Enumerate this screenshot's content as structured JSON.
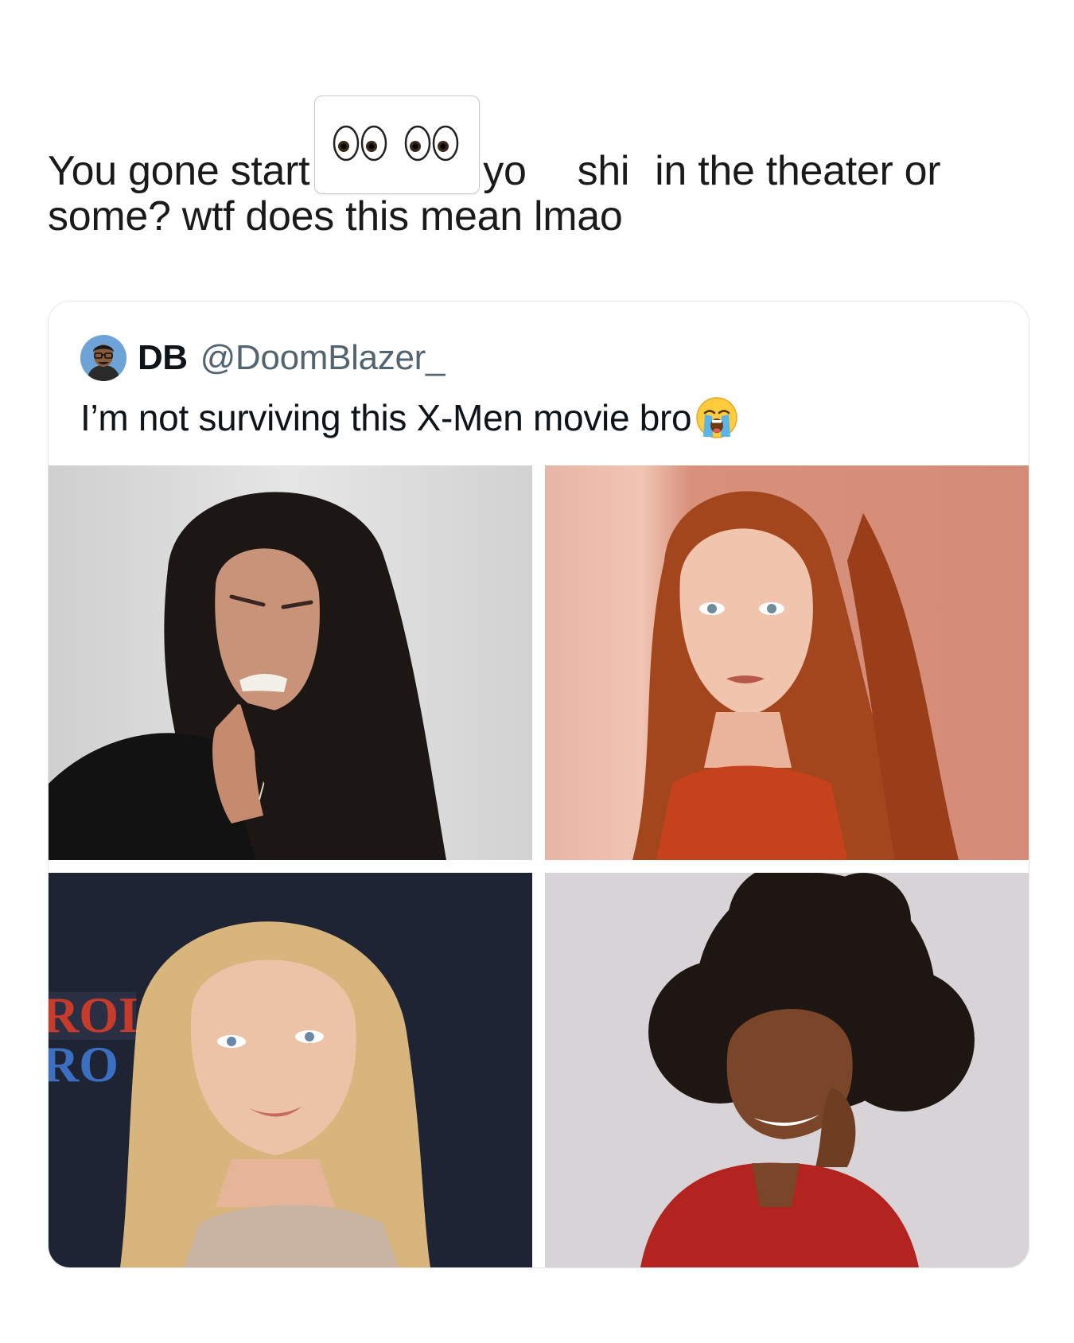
{
  "post": {
    "caption_part1": "You gone start",
    "caption_emoji": "eyes-emoji-row",
    "caption_part2": "yo",
    "caption_part3": "shi",
    "caption_part4": "in the theater or",
    "caption_line2": "some? wtf does this mean lmao"
  },
  "quoted_tweet": {
    "display_name": "DB",
    "handle": "@DoomBlazer_",
    "text": "I’m not surviving this X-Men movie bro",
    "text_emoji": "loudly-crying-face-emoji",
    "avatar_icon": "cartoon-avatar-icon",
    "photos": [
      {
        "name": "photo-dark-hair-woman",
        "bg": "#dcdcdc",
        "hair": "#1c1614",
        "top": "#121212"
      },
      {
        "name": "photo-red-hair-woman",
        "bg": "#d99a85",
        "hair": "#a3461e",
        "top": "#c5421c"
      },
      {
        "name": "photo-blonde-woman",
        "bg": "#1f2435",
        "hair": "#d8b57c",
        "top": "#c9b3a3"
      },
      {
        "name": "photo-curly-hair-woman",
        "bg": "#d8d3d6",
        "hair": "#1e1612",
        "top": "#b3231f"
      }
    ]
  },
  "colors": {
    "text_primary": "#0f1419",
    "text_secondary": "#536471",
    "card_border": "#e5e5e5"
  }
}
